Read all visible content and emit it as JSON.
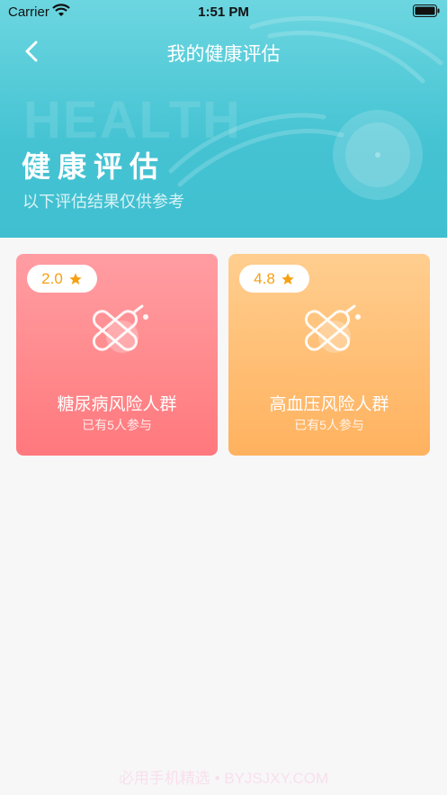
{
  "status_bar": {
    "carrier": "Carrier",
    "time": "1:51 PM"
  },
  "nav": {
    "title": "我的健康评估"
  },
  "hero": {
    "bg_text": "HEALTH",
    "title": "健康评估",
    "subtitle": "以下评估结果仅供参考"
  },
  "cards": [
    {
      "rating": "2.0",
      "title": "糖尿病风险人群",
      "participants": "已有5人参与"
    },
    {
      "rating": "4.8",
      "title": "高血压风险人群",
      "participants": "已有5人参与"
    }
  ],
  "watermark": "必用手机精选 • BYJSJXY.COM",
  "colors": {
    "header": "#45c3d3",
    "card_pink": "#ff8a8d",
    "card_orange": "#ffbe74",
    "star": "#f6a012"
  }
}
